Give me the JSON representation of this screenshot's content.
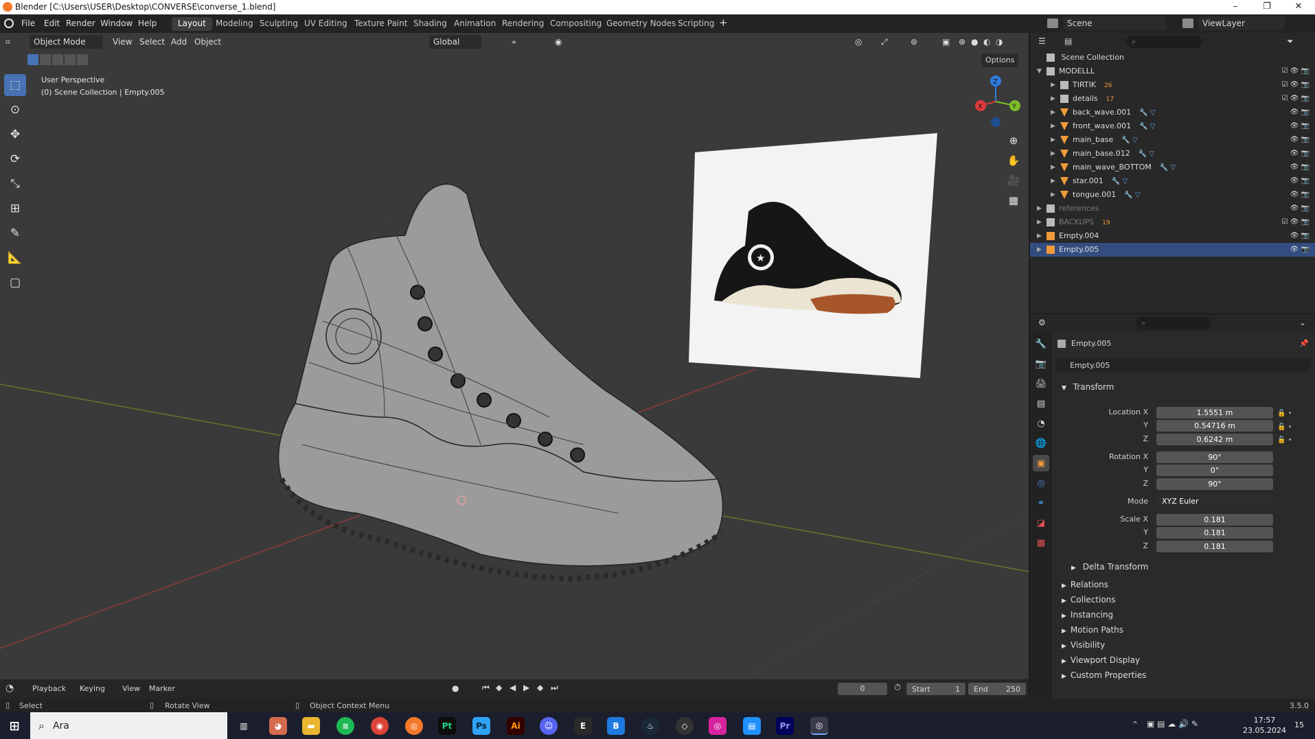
{
  "window": {
    "title": "Blender [C:\\Users\\USER\\Desktop\\CONVERSE\\converse_1.blend]",
    "controls": [
      "–",
      "❐",
      "✕"
    ]
  },
  "menu": [
    "File",
    "Edit",
    "Render",
    "Window",
    "Help"
  ],
  "workspaces": [
    "Layout",
    "Modeling",
    "Sculpting",
    "UV Editing",
    "Texture Paint",
    "Shading",
    "Animation",
    "Rendering",
    "Compositing",
    "Geometry Nodes",
    "Scripting"
  ],
  "workspace_add": "+",
  "scene": {
    "label": "Scene",
    "view_layer": "ViewLayer"
  },
  "viewport": {
    "mode": "Object Mode",
    "menus": [
      "View",
      "Select",
      "Add",
      "Object"
    ],
    "orientation": "Global",
    "options": "Options",
    "info_line1": "User Perspective",
    "info_line2": "(0) Scene Collection | Empty.005",
    "gizmo": {
      "z": "Z",
      "y": "Y",
      "x": "X"
    }
  },
  "outliner": {
    "root": "Scene Collection",
    "items": [
      {
        "name": "MODELLL",
        "level": 1,
        "type": "collection",
        "checked": true
      },
      {
        "name": "TIRTIK",
        "level": 2,
        "type": "collection",
        "badge": "26",
        "checked": true
      },
      {
        "name": "details",
        "level": 2,
        "type": "collection",
        "badge": "17",
        "checked": true
      },
      {
        "name": "back_wave.001",
        "level": 2,
        "type": "mesh"
      },
      {
        "name": "front_wave.001",
        "level": 2,
        "type": "mesh"
      },
      {
        "name": "main_base",
        "level": 2,
        "type": "mesh"
      },
      {
        "name": "main_base.012",
        "level": 2,
        "type": "mesh"
      },
      {
        "name": "main_wave_BOTTOM",
        "level": 2,
        "type": "mesh"
      },
      {
        "name": "star.001",
        "level": 2,
        "type": "mesh"
      },
      {
        "name": "tongue.001",
        "level": 2,
        "type": "mesh"
      },
      {
        "name": "references",
        "level": 1,
        "type": "collection",
        "dim": true
      },
      {
        "name": "BACKUPS",
        "level": 1,
        "type": "collection",
        "badge": "19",
        "dim": true,
        "checked": true
      },
      {
        "name": "Empty.004",
        "level": 1,
        "type": "empty"
      },
      {
        "name": "Empty.005",
        "level": 1,
        "type": "empty",
        "selected": true
      }
    ]
  },
  "properties": {
    "object_name": "Empty.005",
    "datablock": "Empty.005",
    "transform_header": "Transform",
    "location": {
      "label": "Location X",
      "x": "1.5551 m",
      "y": "0.54716 m",
      "z": "0.6242 m"
    },
    "rotation": {
      "label": "Rotation X",
      "x": "90°",
      "y": "0°",
      "z": "90°"
    },
    "mode": {
      "label": "Mode",
      "value": "XYZ Euler"
    },
    "scale": {
      "label": "Scale X",
      "x": "0.181",
      "y": "0.181",
      "z": "0.181"
    },
    "axis_y": "Y",
    "axis_z": "Z",
    "delta": "Delta Transform",
    "panels": [
      "Relations",
      "Collections",
      "Instancing",
      "Motion Paths",
      "Visibility",
      "Viewport Display",
      "Custom Properties"
    ]
  },
  "timeline": {
    "menus": [
      "Playback",
      "Keying",
      "View",
      "Marker"
    ],
    "current_frame": "0",
    "start_label": "Start",
    "start": "1",
    "end_label": "End",
    "end": "250"
  },
  "status": {
    "select": "Select",
    "rotate": "Rotate View",
    "context": "Object Context Menu",
    "version": "3.5.0"
  },
  "taskbar": {
    "search": "Ara",
    "time": "17:57",
    "date": "23.05.2024",
    "notif": "15",
    "apps": [
      "Pt",
      "Ps",
      "Ai",
      "Pr"
    ]
  },
  "colors": {
    "accent": "#4772b3",
    "selection": "#334d80",
    "x_axis": "#e03a3a",
    "y_axis": "#7cbf2b",
    "z_axis": "#2f7de0"
  }
}
